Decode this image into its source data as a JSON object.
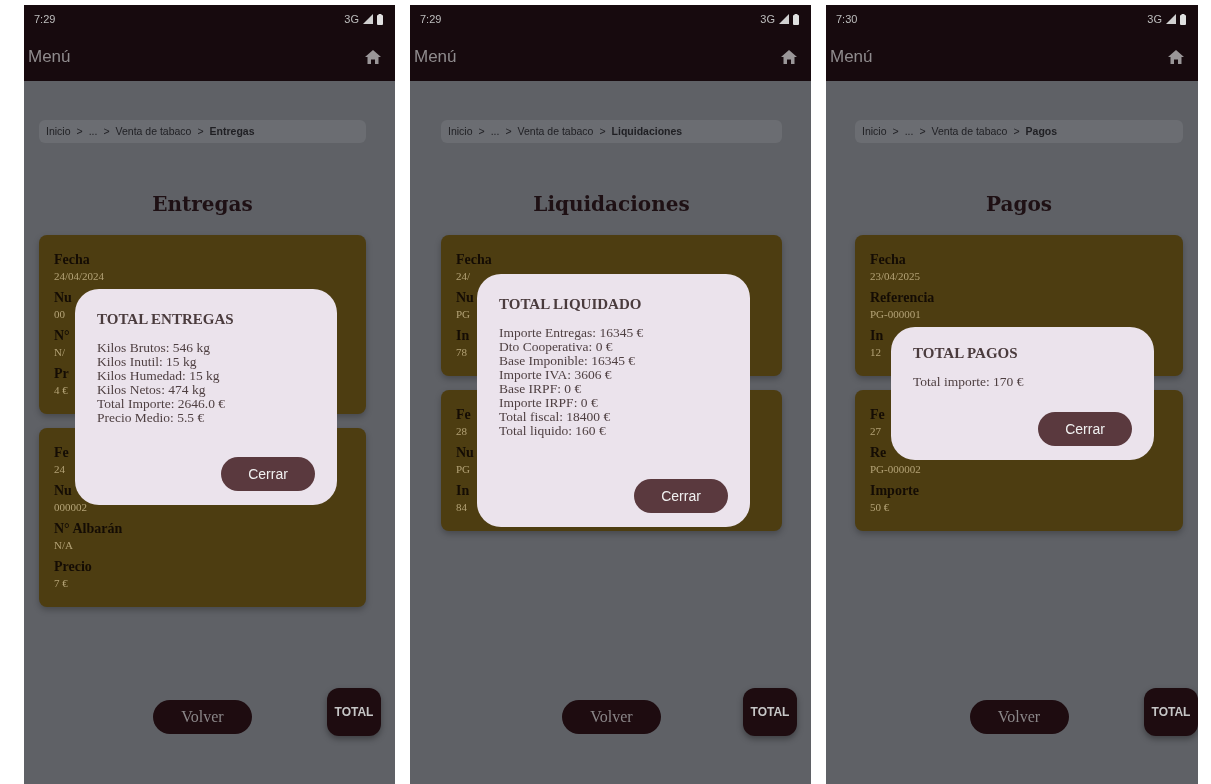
{
  "screens": [
    {
      "status_bar": {
        "time": "7:29",
        "network": "3G"
      },
      "app_bar": {
        "title": "Menú"
      },
      "breadcrumb": [
        {
          "kind": "link",
          "text": "Inicio"
        },
        {
          "kind": "separator",
          "text": ">"
        },
        {
          "kind": "link",
          "text": "..."
        },
        {
          "kind": "separator",
          "text": ">"
        },
        {
          "kind": "link",
          "text": "Venta de tabaco"
        },
        {
          "kind": "separator",
          "text": ">"
        },
        {
          "kind": "current",
          "text": "Entregas"
        }
      ],
      "title": "Entregas",
      "cards": [
        {
          "fields": [
            {
              "label": "Fecha",
              "value": "24/04/2024"
            },
            {
              "label": "Nu",
              "value": "00"
            },
            {
              "label": "N°",
              "value": "N/"
            },
            {
              "label": "Pr",
              "value": "4 €"
            }
          ]
        },
        {
          "fields": [
            {
              "label": "Fe",
              "value": "24"
            },
            {
              "label": "Nu",
              "value": "000002"
            },
            {
              "label": "N° Albarán",
              "value": "N/A"
            },
            {
              "label": "Precio",
              "value": "7 €"
            }
          ]
        }
      ],
      "dialog": {
        "title": "TOTAL ENTREGAS",
        "lines": [
          "Kilos Brutos: 546 kg",
          "Kilos Inutil: 15 kg",
          "Kilos Humedad: 15 kg",
          "Kilos Netos: 474 kg",
          "Total Importe: 2646.0 €",
          "Precio Medio: 5.5 €"
        ],
        "button": "Cerrar"
      },
      "back_button": "Volver",
      "total_button": "TOTAL"
    },
    {
      "status_bar": {
        "time": "7:29",
        "network": "3G"
      },
      "app_bar": {
        "title": "Menú"
      },
      "breadcrumb": [
        {
          "kind": "link",
          "text": "Inicio"
        },
        {
          "kind": "separator",
          "text": ">"
        },
        {
          "kind": "link",
          "text": "..."
        },
        {
          "kind": "separator",
          "text": ">"
        },
        {
          "kind": "link",
          "text": "Venta de tabaco"
        },
        {
          "kind": "separator",
          "text": ">"
        },
        {
          "kind": "current",
          "text": "Liquidaciones"
        }
      ],
      "title": "Liquidaciones",
      "cards": [
        {
          "fields": [
            {
              "label": "Fecha",
              "value": "24/"
            },
            {
              "label": "Nu",
              "value": "PG"
            },
            {
              "label": "In",
              "value": "78"
            }
          ]
        },
        {
          "fields": [
            {
              "label": "Fe",
              "value": "28"
            },
            {
              "label": "Nu",
              "value": "PG"
            },
            {
              "label": "In",
              "value": "84"
            }
          ]
        }
      ],
      "dialog": {
        "title": "TOTAL LIQUIDADO",
        "lines": [
          "Importe Entregas: 16345 €",
          "Dto Cooperativa: 0 €",
          "Base Imponible: 16345 €",
          "Importe IVA: 3606 €",
          "Base IRPF: 0 €",
          "Importe IRPF: 0 €",
          "Total fiscal: 18400 €",
          "Total liquido: 160 €"
        ],
        "button": "Cerrar"
      },
      "back_button": "Volver",
      "total_button": "TOTAL"
    },
    {
      "status_bar": {
        "time": "7:30",
        "network": "3G"
      },
      "app_bar": {
        "title": "Menú"
      },
      "breadcrumb": [
        {
          "kind": "link",
          "text": "Inicio"
        },
        {
          "kind": "separator",
          "text": ">"
        },
        {
          "kind": "link",
          "text": "..."
        },
        {
          "kind": "separator",
          "text": ">"
        },
        {
          "kind": "link",
          "text": "Venta de tabaco"
        },
        {
          "kind": "separator",
          "text": ">"
        },
        {
          "kind": "current",
          "text": "Pagos"
        }
      ],
      "title": "Pagos",
      "cards": [
        {
          "fields": [
            {
              "label": "Fecha",
              "value": "23/04/2025"
            },
            {
              "label": "Referencia",
              "value": "PG-000001"
            },
            {
              "label": "In",
              "value": "12"
            }
          ]
        },
        {
          "fields": [
            {
              "label": "Fe",
              "value": "27"
            },
            {
              "label": "Re",
              "value": "PG-000002"
            },
            {
              "label": "Importe",
              "value": "50 €"
            }
          ]
        }
      ],
      "dialog": {
        "title": "TOTAL PAGOS",
        "lines": [
          "Total importe: 170 €"
        ],
        "button": "Cerrar"
      },
      "back_button": "Volver",
      "total_button": "TOTAL"
    }
  ]
}
